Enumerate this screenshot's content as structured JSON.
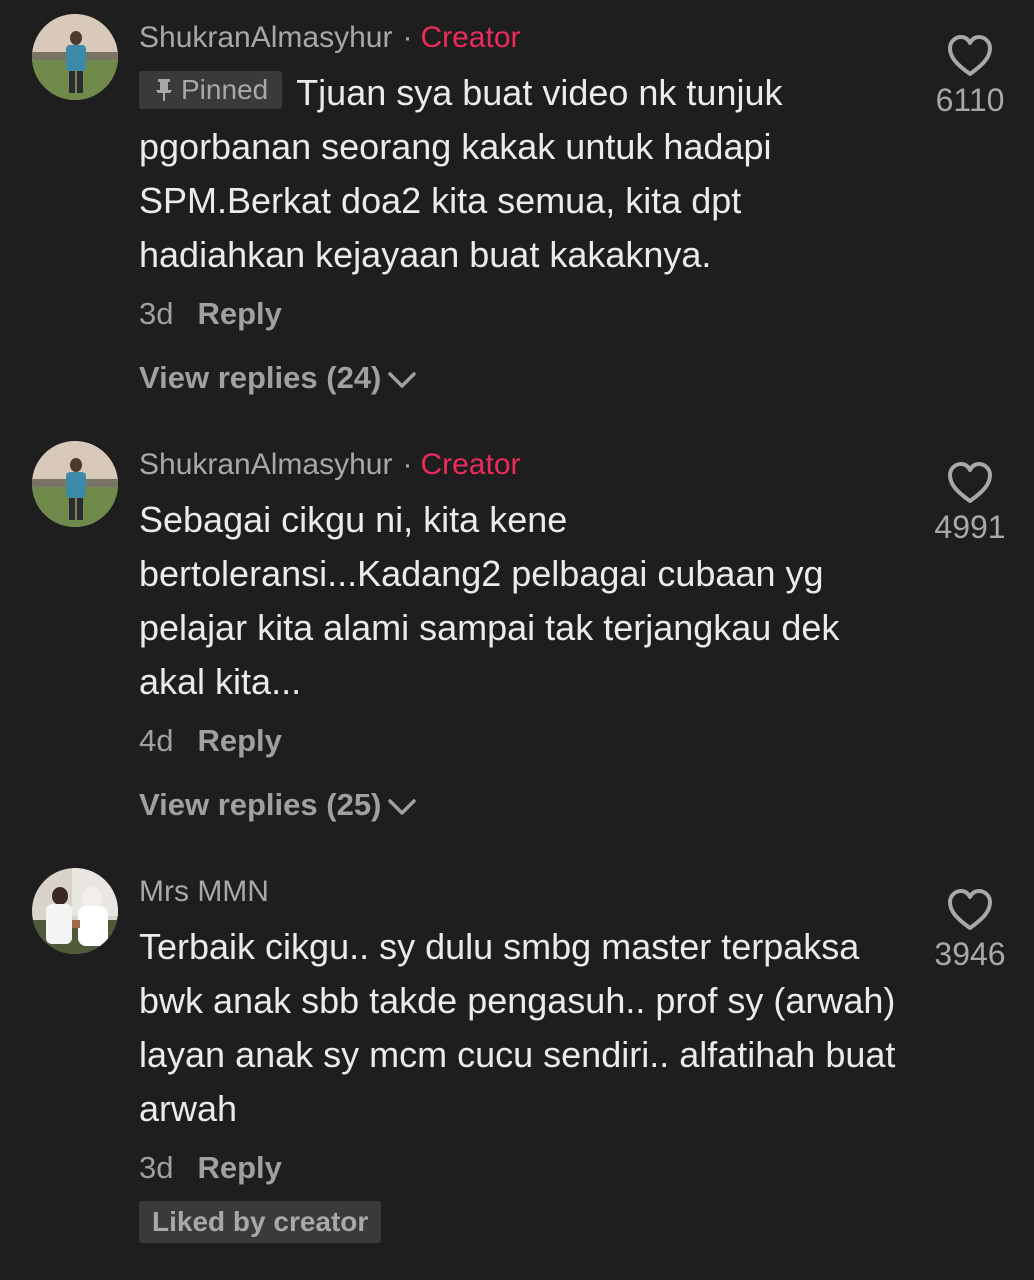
{
  "comments": [
    {
      "username": "ShukranAlmasyhur",
      "separator": "·",
      "badge": "Creator",
      "pinned_label": "Pinned",
      "text": "Tjuan sya buat video nk tunjuk pgorbanan seorang kakak untuk hadapi SPM.Berkat doa2 kita semua, kita dpt hadiahkan kejayaan buat kakaknya.",
      "time": "3d",
      "reply_label": "Reply",
      "view_replies": "View replies (24)",
      "likes": "6110",
      "like_icon": "heart-outline-icon"
    },
    {
      "username": "ShukranAlmasyhur",
      "separator": "·",
      "badge": "Creator",
      "text": "Sebagai cikgu ni, kita kene bertoleransi...Kadang2 pelbagai cubaan yg pelajar kita alami sampai tak terjangkau dek akal kita...",
      "time": "4d",
      "reply_label": "Reply",
      "view_replies": "View replies (25)",
      "likes": "4991",
      "like_icon": "heart-outline-icon"
    },
    {
      "username": "Mrs MMN",
      "text": "Terbaik cikgu.. sy dulu smbg master terpaksa bwk anak sbb takde pengasuh.. prof sy (arwah) layan anak sy mcm cucu sendiri.. alfatihah buat arwah",
      "time": "3d",
      "reply_label": "Reply",
      "liked_by_creator": "Liked by creator",
      "likes": "3946",
      "like_icon": "heart-outline-icon"
    }
  ],
  "colors": {
    "background": "#1e1e1e",
    "creator_badge": "#ee2a5a",
    "text_primary": "#ebebeb",
    "text_secondary": "#a8a8a8",
    "chip_background": "#3a3a3a"
  }
}
